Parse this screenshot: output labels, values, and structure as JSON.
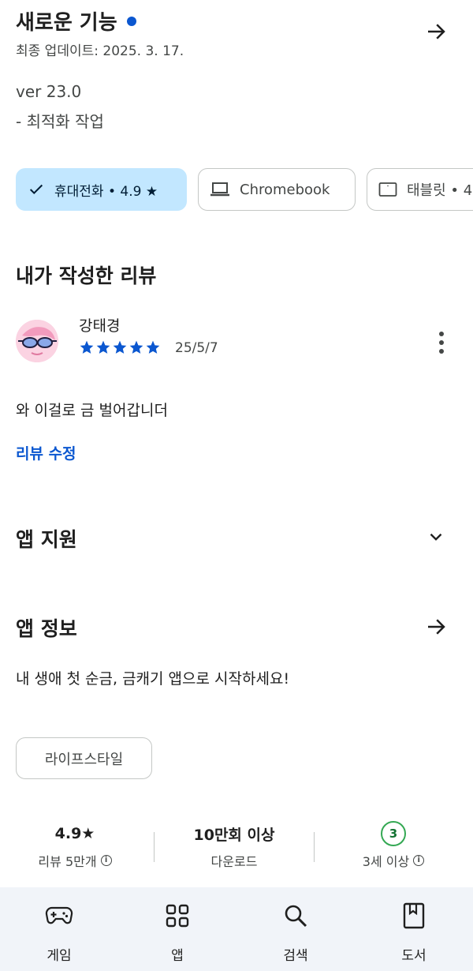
{
  "whats_new": {
    "title": "새로운 기능",
    "update_date": "최종 업데이트: 2025. 3. 17.",
    "version": "ver 23.0",
    "notes": "- 최적화 작업"
  },
  "device_chips": [
    {
      "label": "휴대전화 • 4.9 ★",
      "icon": "check-icon",
      "selected": true
    },
    {
      "label": "Chromebook",
      "icon": "laptop-icon",
      "selected": false
    },
    {
      "label": "태블릿 • 4",
      "icon": "tablet-icon",
      "selected": false
    }
  ],
  "my_review": {
    "section_title": "내가 작성한 리뷰",
    "reviewer_name": "강태경",
    "rating": 5,
    "date": "25/5/7",
    "text": "와 이걸로 금 벌어갑니더",
    "edit_label": "리뷰 수정"
  },
  "app_support": {
    "title": "앱 지원"
  },
  "app_info": {
    "title": "앱 정보",
    "description": "내 생애 첫 순금, 금캐기 앱으로 시작하세요!",
    "category": "라이프스타일"
  },
  "stats": {
    "rating_value": "4.9★",
    "rating_label": "리뷰 5만개",
    "downloads_value": "10만회 이상",
    "downloads_label": "다운로드",
    "age_value": "3",
    "age_label": "3세 이상"
  },
  "bottom_nav": [
    {
      "label": "게임",
      "icon": "gamepad-icon"
    },
    {
      "label": "앱",
      "icon": "apps-grid-icon"
    },
    {
      "label": "검색",
      "icon": "search-icon"
    },
    {
      "label": "도서",
      "icon": "book-icon"
    }
  ],
  "colors": {
    "accent": "#0b57d0",
    "selected_chip_bg": "#c2e7ff",
    "nav_bg": "#f1f4f9",
    "age_badge": "#34a853"
  }
}
